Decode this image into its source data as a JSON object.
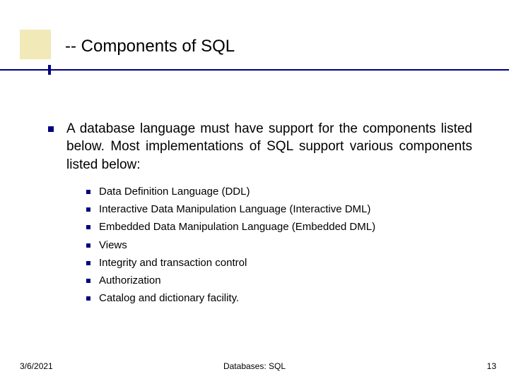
{
  "title": "-- Components of SQL",
  "main_bullet": "A database language must have support for the components listed below. Most implementations of SQL support various components listed below:",
  "sub_bullets": {
    "b0": "Data Definition Language (DDL)",
    "b1": "Interactive Data Manipulation Language (Interactive DML)",
    "b2": "Embedded Data Manipulation Language (Embedded DML)",
    "b3": "Views",
    "b4": "Integrity and transaction control",
    "b5": "Authorization",
    "b6": "Catalog and dictionary facility."
  },
  "footer": {
    "date": "3/6/2021",
    "center": "Databases: SQL",
    "page": "13"
  }
}
